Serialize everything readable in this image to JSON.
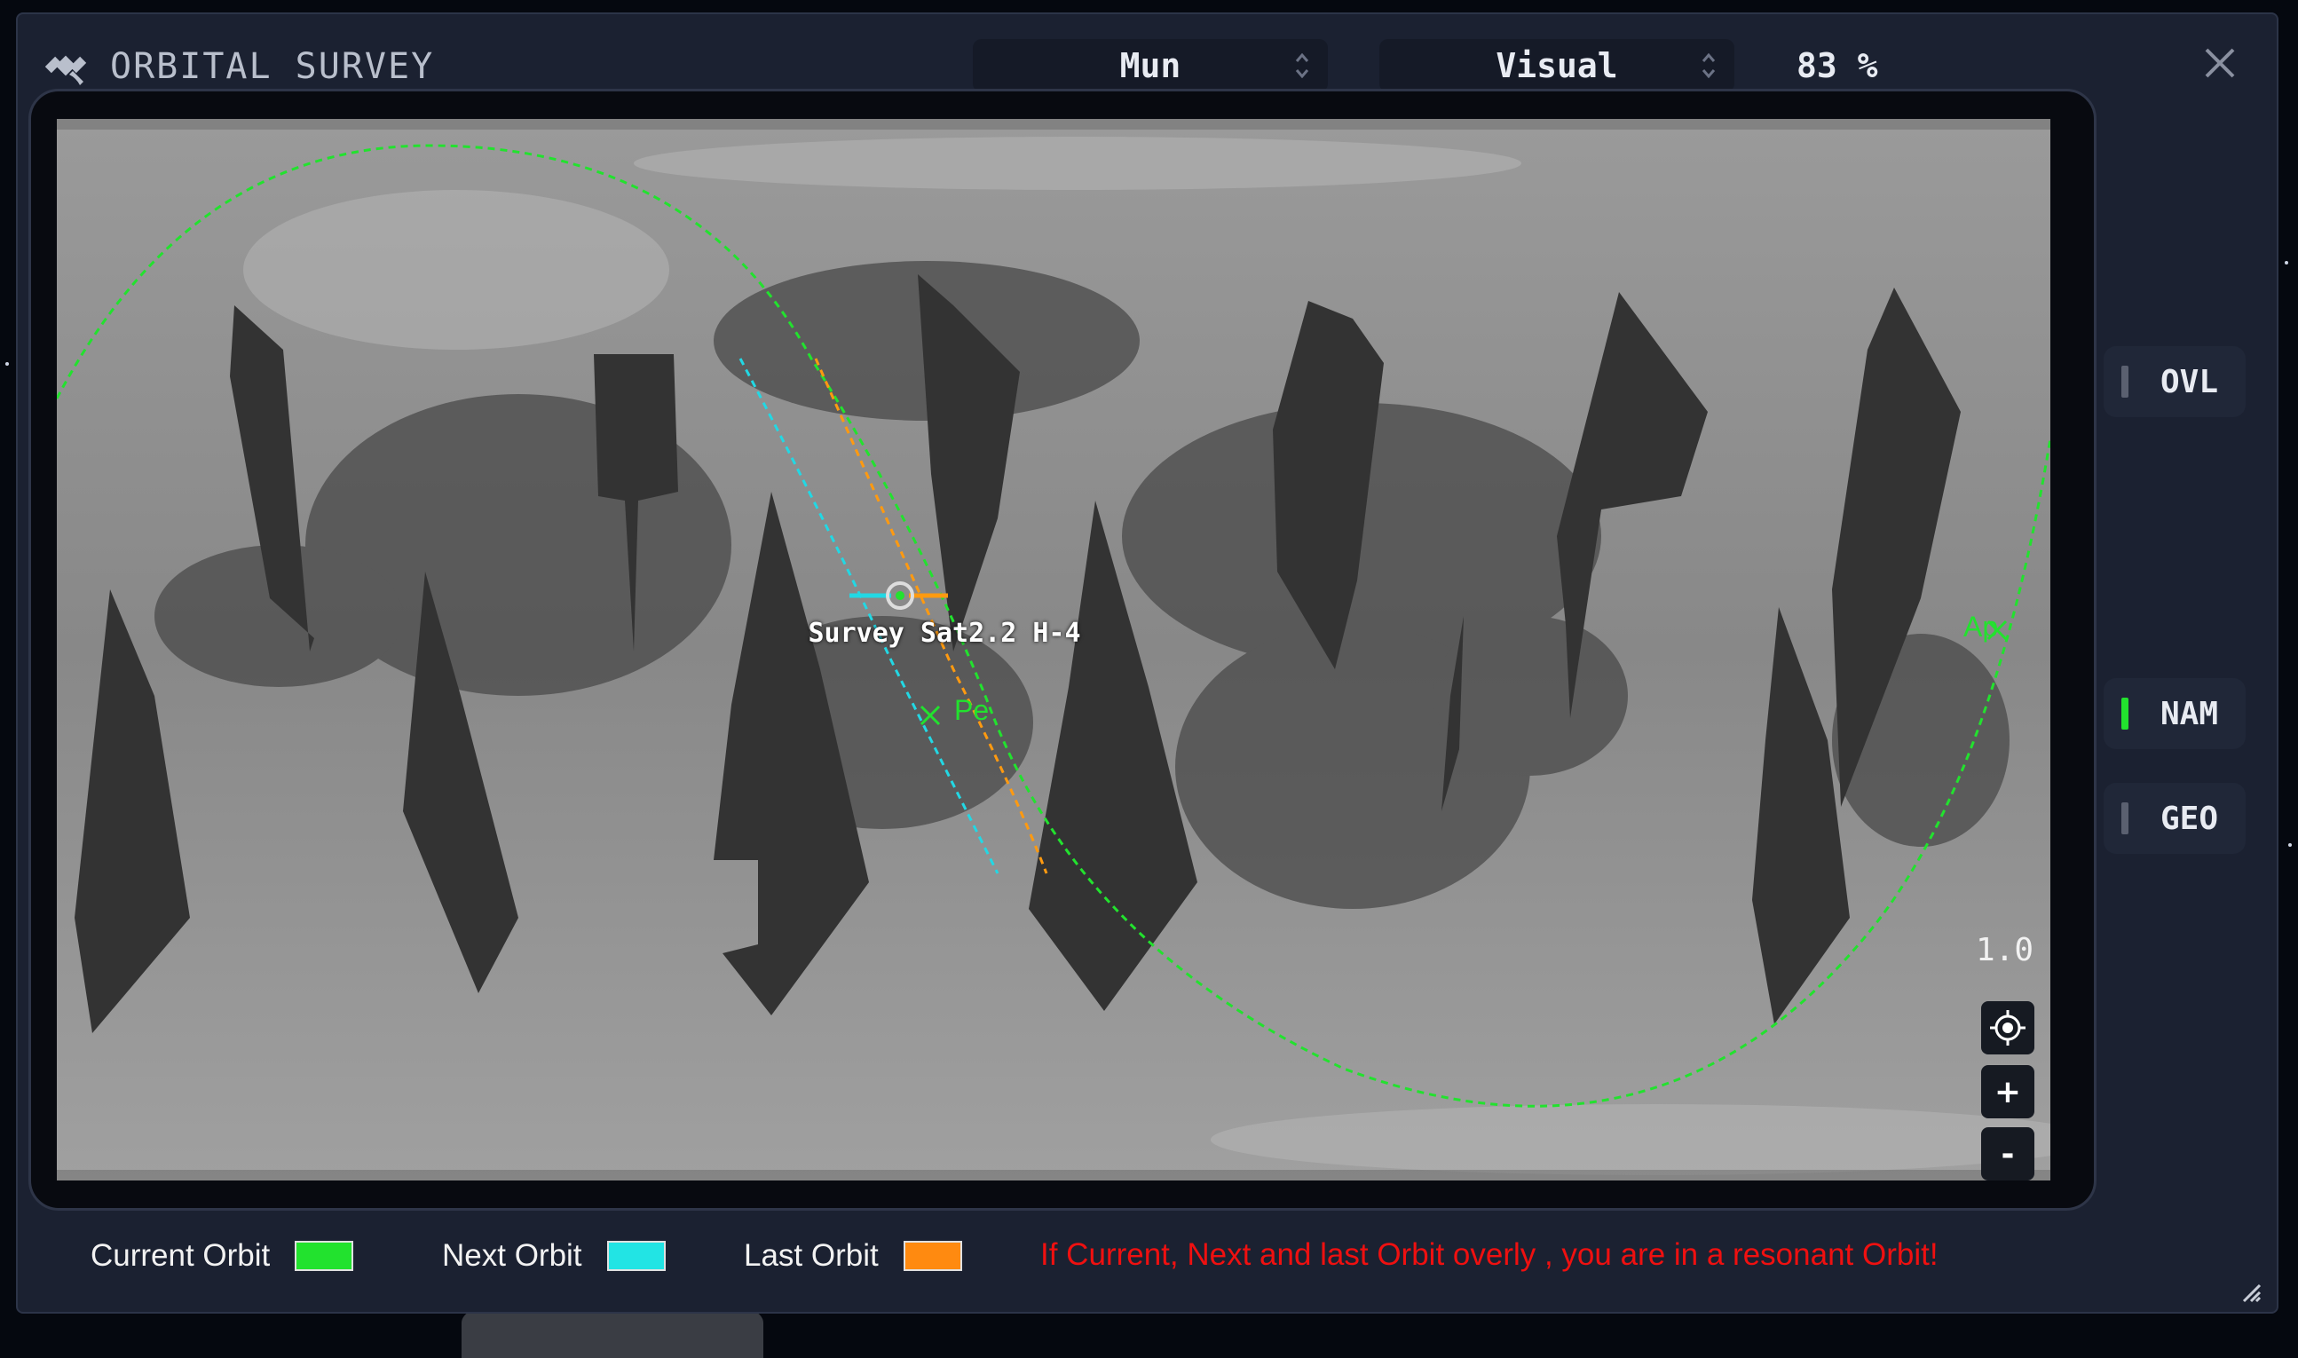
{
  "window": {
    "title": "ORBITAL SURVEY",
    "body_selector": {
      "value": "Mun"
    },
    "mode_selector": {
      "value": "Visual"
    },
    "scan_percent": "83 %"
  },
  "map": {
    "vessel_label": "Survey Sat2.2 H-4",
    "periapsis_label": "Pe",
    "apoapsis_label": "Ap",
    "zoom_level": "1.0",
    "zoom_in_label": "+",
    "zoom_out_label": "-"
  },
  "side_buttons": [
    {
      "label": "OVL",
      "active": false
    },
    {
      "label": "NAM",
      "active": true
    },
    {
      "label": "GEO",
      "active": false
    }
  ],
  "legend": [
    {
      "label": "Current Orbit",
      "color": "#22e22e"
    },
    {
      "label": "Next Orbit",
      "color": "#22e4e4"
    },
    {
      "label": "Last Orbit",
      "color": "#ff8a10"
    }
  ],
  "warning": "If Current, Next and last Orbit overly , you are in a resonant Orbit!",
  "icons": {
    "title": "satellite-icon",
    "selector": "chevron-updown-icon",
    "close": "close-icon",
    "center": "crosshair-icon",
    "resize": "resize-grip-icon"
  }
}
